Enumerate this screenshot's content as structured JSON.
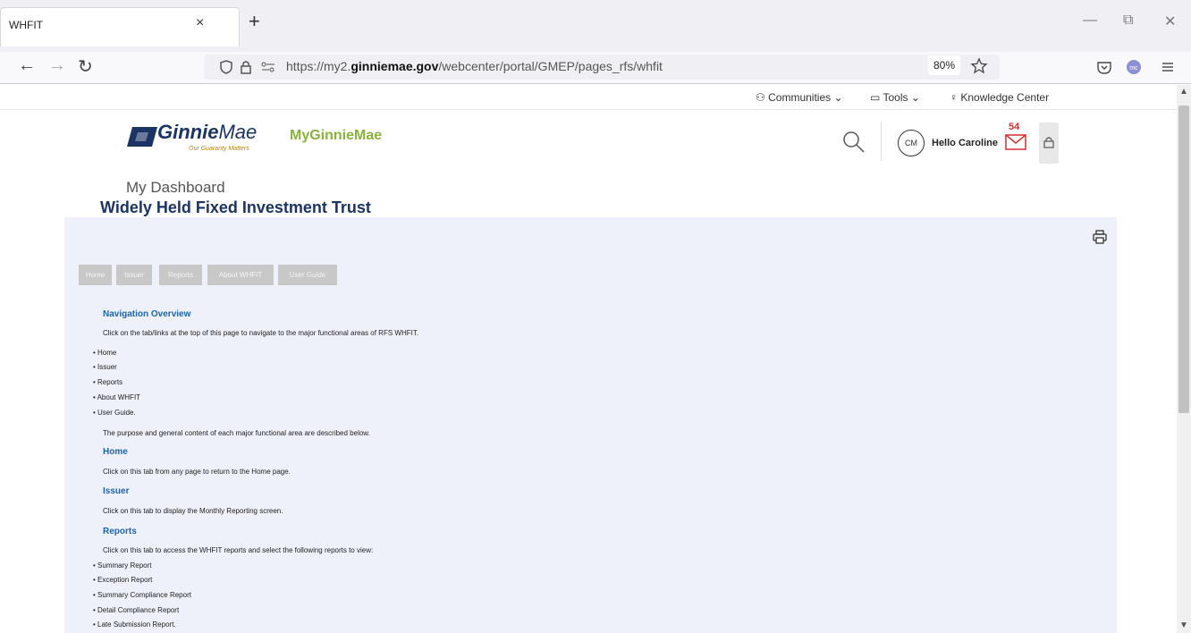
{
  "browser": {
    "tab_title": "WHFIT",
    "tab_close": "×",
    "new_tab": "+",
    "url_prefix": "https://my2.",
    "url_domain": "ginniemae.gov",
    "url_path": "/webcenter/portal/GMEP/pages_rfs/whfit",
    "zoom": "80%",
    "window_minimize": "—",
    "window_restore": "⧉",
    "window_close": "✕"
  },
  "topnav": {
    "communities": "Communities",
    "tools": "Tools",
    "knowledge_center": "Knowledge Center"
  },
  "header": {
    "logo_main": "Ginnie",
    "logo_mae": "Mae",
    "logo_tagline": "Our Guaranty Matters",
    "app_name": "MyGinnieMae",
    "avatar_initials": "CM",
    "greeting": "Hello Caroline",
    "mail_count": "54"
  },
  "breadcrumb": "My Dashboard",
  "page_title": "Widely Held Fixed Investment Trust",
  "tabs": [
    "Home",
    "Issuer",
    "Reports",
    "About WHFIT",
    "User Guide"
  ],
  "content": {
    "nav_heading": "Navigation Overview",
    "nav_intro": "Click on the tab/links at the top of this page to navigate to the major functional areas of RFS WHFIT.",
    "nav_items": [
      "Home",
      "Issuer",
      "Reports",
      "About WHFIT",
      "User Guide."
    ],
    "purpose": "The purpose and general content of each major functional area are described below.",
    "home_heading": "Home",
    "home_text": "Click on this tab from any page to return to the Home page.",
    "issuer_heading": "Issuer",
    "issuer_text": "Click on this tab to display the Monthly Reporting screen.",
    "reports_heading": "Reports",
    "reports_text": "Click on this tab to access the WHFIT reports and select the following reports to view:",
    "report_items": [
      "Summary Report",
      "Exception Report",
      "Summary Compliance Report",
      "Detail Compliance Report",
      "Late Submission Report."
    ]
  },
  "colors": {
    "brand_navy": "#1c3464",
    "brand_green": "#8ab339",
    "link_blue": "#1c64b0",
    "mail_red": "#d32f2f",
    "panel_bg": "#eef1fa"
  }
}
